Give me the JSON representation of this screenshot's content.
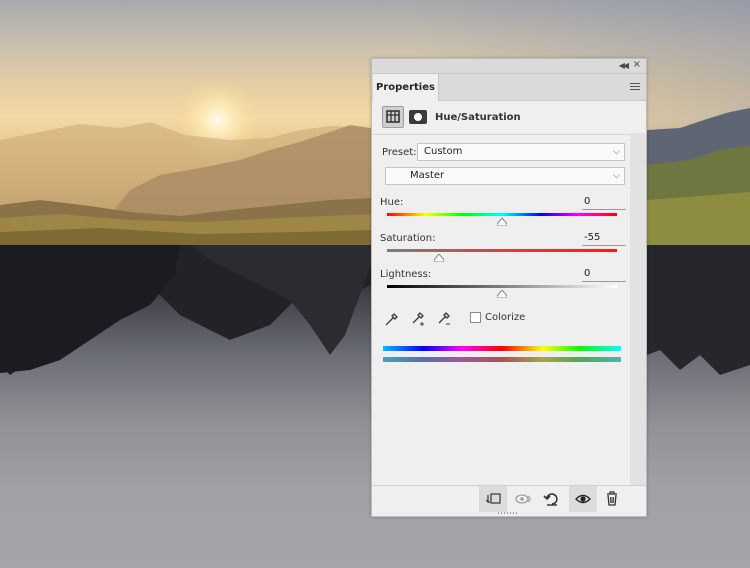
{
  "panel": {
    "tab_label": "Properties",
    "adjustment_title": "Hue/Saturation",
    "preset_label": "Preset:",
    "preset_value": "Custom",
    "channel_value": "Master",
    "hue": {
      "label": "Hue:",
      "value": "0",
      "level": 0
    },
    "saturation": {
      "label": "Saturation:",
      "value": "-55",
      "level": -55
    },
    "lightness": {
      "label": "Lightness:",
      "value": "0",
      "level": 0
    },
    "colorize_label": "Colorize",
    "colorize_checked": false
  },
  "icons": {
    "collapse": "double-chevron-left-icon",
    "close": "close-icon",
    "menu": "panel-menu-icon",
    "adjustment": "hue-saturation-layer-icon",
    "mask": "layer-mask-icon",
    "target": "on-image-adjustment-hand-icon",
    "eyedroppers": [
      "eyedropper-icon",
      "eyedropper-add-icon",
      "eyedropper-subtract-icon"
    ],
    "bottom": [
      "clip-to-layer-icon",
      "view-previous-state-icon",
      "reset-icon",
      "visibility-eye-icon",
      "trash-icon"
    ]
  },
  "colors": {
    "panel_bg": "#efefef",
    "header_bg": "#dadada",
    "accent": "#262626"
  }
}
